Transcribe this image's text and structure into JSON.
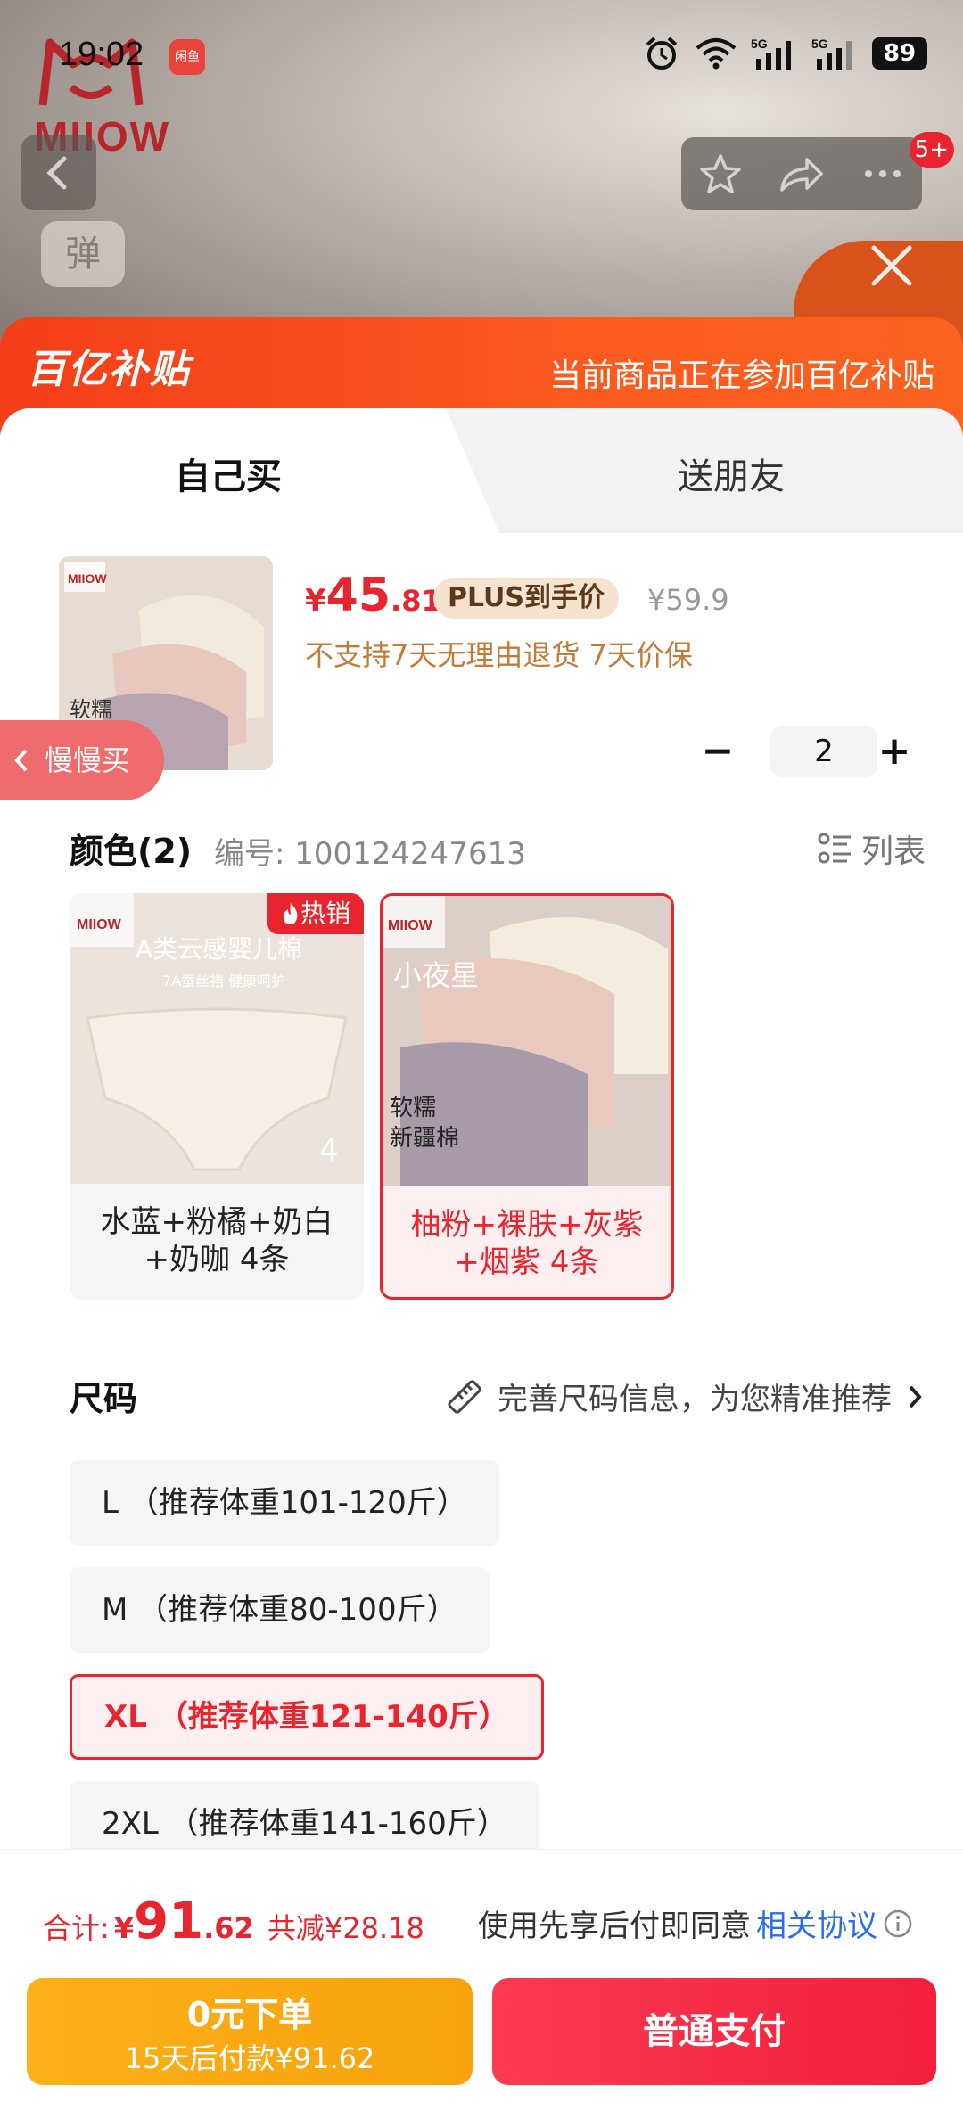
{
  "status_bar": {
    "time": "19:02",
    "app_badge": "闲鱼",
    "battery": "89",
    "network_1": "5G",
    "network_2": "5G"
  },
  "background": {
    "brand": "MIIOW",
    "tag": "弹",
    "notification_count": "5+"
  },
  "subsidy": {
    "logo": "百亿补贴",
    "notice": "当前商品正在参加百亿补贴"
  },
  "tabs": {
    "self": "自己买",
    "friend": "送朋友"
  },
  "product": {
    "currency": "¥",
    "price_int": "45",
    "price_dec": ".81",
    "plus_tag": "PLUS到手价",
    "original_price": "¥59.9",
    "policy": "不支持7天无理由退货  7天价保",
    "quantity": "2",
    "minus": "−",
    "plus": "+"
  },
  "slow_buy": "慢慢买",
  "color": {
    "title": "颜色(2)",
    "code": "编号: 100124247613",
    "list_view": "列表",
    "options": [
      {
        "label_line1": "水蓝+粉橘+奶白",
        "label_line2": "+奶咖 4条",
        "hot": "热销",
        "image_caption": "A类云感婴儿棉",
        "image_sub": "7A蚕丝裆 健康呵护",
        "badge": "4"
      },
      {
        "label_line1": "柚粉+裸肤+灰紫",
        "label_line2": "+烟紫 4条",
        "image_caption": "小夜星",
        "image_sub": "软糯\n新疆棉"
      }
    ],
    "selected_index": 1
  },
  "size": {
    "title": "尺码",
    "hint": "完善尺码信息，为您精准推荐",
    "options": [
      {
        "label": "L （推荐体重101-120斤）"
      },
      {
        "label": "M （推荐体重80-100斤）"
      },
      {
        "label": "XL （推荐体重121-140斤）"
      },
      {
        "label": "2XL （推荐体重141-160斤）"
      }
    ],
    "selected_index": 2
  },
  "footer": {
    "total_label": "合计:",
    "total_currency": "¥",
    "total_int": "91",
    "total_dec": ".62",
    "savings": "共减¥28.18",
    "agree_text": "使用先享后付即同意",
    "agree_link": "相关协议",
    "later_line1": "0元下单",
    "later_line2": "15天后付款¥91.62",
    "pay_label": "普通支付"
  },
  "colors": {
    "accent": "#e8252f",
    "subsidy": "#f9521c",
    "later_button": "#fcb019",
    "pay_button": "#f22a45",
    "link": "#2b6de8"
  }
}
